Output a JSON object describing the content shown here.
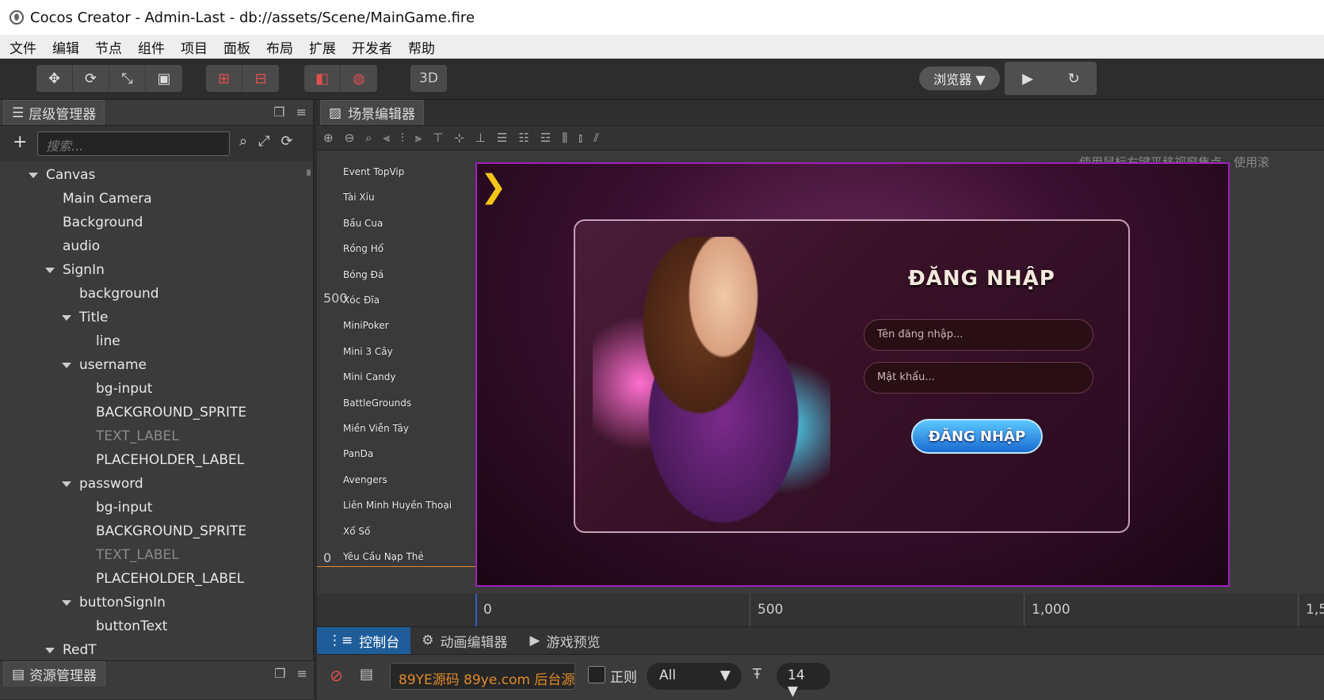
{
  "window": {
    "title": "Cocos Creator - Admin-Last - db://assets/Scene/MainGame.fire"
  },
  "menu": [
    "文件",
    "编辑",
    "节点",
    "组件",
    "项目",
    "面板",
    "布局",
    "扩展",
    "开发者",
    "帮助"
  ],
  "toolbar": {
    "btn_3d": "3D",
    "browser_dropdown": "浏览器 ▼",
    "play_icon": "▶",
    "refresh_icon": "↻"
  },
  "hierarchy": {
    "tab_label": "层级管理器",
    "search_placeholder": "搜索...",
    "nodes": [
      {
        "label": "Canvas",
        "depth": 0,
        "expanded": true,
        "dim": false
      },
      {
        "label": "Main Camera",
        "depth": 1,
        "expanded": null,
        "dim": false
      },
      {
        "label": "Background",
        "depth": 1,
        "expanded": null,
        "dim": false
      },
      {
        "label": "audio",
        "depth": 1,
        "expanded": null,
        "dim": false
      },
      {
        "label": "SignIn",
        "depth": 1,
        "expanded": true,
        "dim": false
      },
      {
        "label": "background",
        "depth": 2,
        "expanded": null,
        "dim": false
      },
      {
        "label": "Title",
        "depth": 2,
        "expanded": true,
        "dim": false
      },
      {
        "label": "line",
        "depth": 3,
        "expanded": null,
        "dim": false
      },
      {
        "label": "username",
        "depth": 2,
        "expanded": true,
        "dim": false
      },
      {
        "label": "bg-input",
        "depth": 3,
        "expanded": null,
        "dim": false
      },
      {
        "label": "BACKGROUND_SPRITE",
        "depth": 3,
        "expanded": null,
        "dim": false
      },
      {
        "label": "TEXT_LABEL",
        "depth": 3,
        "expanded": null,
        "dim": true
      },
      {
        "label": "PLACEHOLDER_LABEL",
        "depth": 3,
        "expanded": null,
        "dim": false
      },
      {
        "label": "password",
        "depth": 2,
        "expanded": true,
        "dim": false
      },
      {
        "label": "bg-input",
        "depth": 3,
        "expanded": null,
        "dim": false
      },
      {
        "label": "BACKGROUND_SPRITE",
        "depth": 3,
        "expanded": null,
        "dim": false
      },
      {
        "label": "TEXT_LABEL",
        "depth": 3,
        "expanded": null,
        "dim": true
      },
      {
        "label": "PLACEHOLDER_LABEL",
        "depth": 3,
        "expanded": null,
        "dim": false
      },
      {
        "label": "buttonSignIn",
        "depth": 2,
        "expanded": true,
        "dim": false
      },
      {
        "label": "buttonText",
        "depth": 3,
        "expanded": null,
        "dim": false
      },
      {
        "label": "RedT",
        "depth": 1,
        "expanded": true,
        "dim": false
      }
    ]
  },
  "assets": {
    "tab_label": "资源管理器"
  },
  "scene": {
    "tab_label": "场景编辑器",
    "hint": "使用鼠标右键平移视窗焦点，使用滚",
    "ruler_y": [
      "500",
      "0"
    ],
    "ruler_x": [
      "0",
      "500",
      "1,000",
      "1,5"
    ],
    "game_list": [
      "Event TopVip",
      "Tài Xỉu",
      "Bầu Cua",
      "Rồng Hổ",
      "Bóng Đá",
      "Xóc Đĩa",
      "MiniPoker",
      "Mini 3 Cây",
      "Mini Candy",
      "BattleGrounds",
      "Miền Viễn Tây",
      "PanDa",
      "Avengers",
      "Liên Minh Huyền Thoại",
      "Xổ Số",
      "Yêu Cầu Nạp Thẻ"
    ],
    "dialog": {
      "title": "ĐĂNG NHẬP",
      "username_placeholder": "Tên đăng nhập...",
      "password_placeholder": "Mật khẩu...",
      "button": "ĐĂNG NHẬP"
    }
  },
  "console": {
    "tabs": [
      "控制台",
      "动画编辑器",
      "游戏预览"
    ],
    "filter_value": "89YE源码 89ye.com 后台源",
    "regex_label": "正则",
    "level_select": "All",
    "font_size": "14 ▼"
  },
  "colors": {
    "accent": "#1f5d9a",
    "selection_border": "#a020c0",
    "filter_text": "#e08a2a"
  }
}
